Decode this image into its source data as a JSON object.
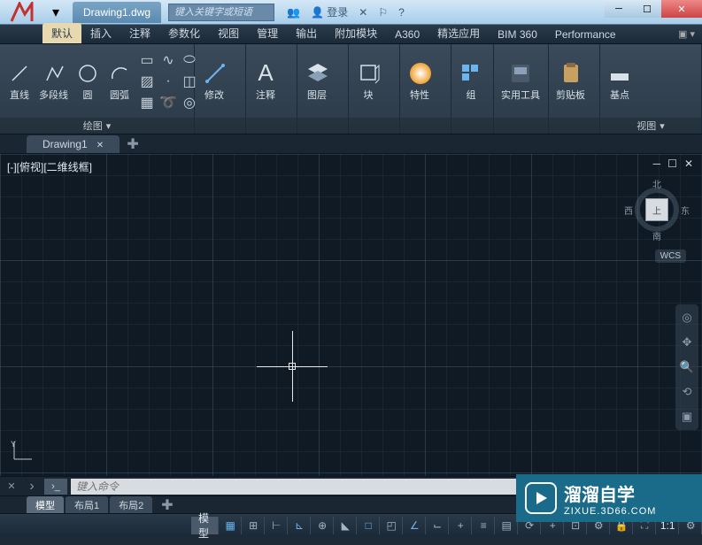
{
  "titlebar": {
    "doc_title": "Drawing1.dwg",
    "search_placeholder": "键入关键字或短语",
    "login_label": "登录"
  },
  "ribbon_tabs": [
    "默认",
    "插入",
    "注释",
    "参数化",
    "视图",
    "管理",
    "输出",
    "附加模块",
    "A360",
    "精选应用",
    "BIM 360",
    "Performance"
  ],
  "ribbon_panels": {
    "draw_title": "绘图",
    "draw_tools": {
      "line": "直线",
      "polyline": "多段线",
      "circle": "圆",
      "arc": "圆弧"
    },
    "modify": "修改",
    "annotate": "注释",
    "layer": "图层",
    "block": "块",
    "props": "特性",
    "group": "组",
    "utils": "实用工具",
    "clipboard": "剪贴板",
    "base": "基点",
    "view": "视图"
  },
  "doc_tabs": {
    "active": "Drawing1"
  },
  "viewport": {
    "label": "[-][俯视][二维线框]",
    "cube_face": "上",
    "dir_n": "北",
    "dir_s": "南",
    "dir_e": "东",
    "dir_w": "西",
    "wcs": "WCS"
  },
  "command": {
    "placeholder": "键入命令"
  },
  "layout_tabs": {
    "model": "模型",
    "l1": "布局1",
    "l2": "布局2"
  },
  "status_bar": {
    "model": "模型",
    "ratio": "1:1"
  },
  "watermark": {
    "main": "溜溜自学",
    "sub": "ZIXUE.3D66.COM"
  }
}
